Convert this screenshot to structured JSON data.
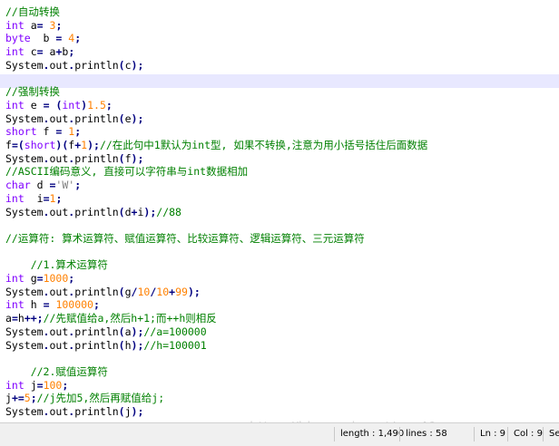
{
  "editor": {
    "lines": [
      [
        [
          "cmt",
          "//自动转换"
        ]
      ],
      [
        [
          "kw",
          "int"
        ],
        [
          "plain",
          " a"
        ],
        [
          "op",
          "="
        ],
        [
          "plain",
          " "
        ],
        [
          "num",
          "3"
        ],
        [
          "op",
          ";"
        ]
      ],
      [
        [
          "kw",
          "byte"
        ],
        [
          "plain",
          "  b "
        ],
        [
          "op",
          "="
        ],
        [
          "plain",
          " "
        ],
        [
          "num",
          "4"
        ],
        [
          "op",
          ";"
        ]
      ],
      [
        [
          "kw",
          "int"
        ],
        [
          "plain",
          " c"
        ],
        [
          "op",
          "="
        ],
        [
          "plain",
          " a"
        ],
        [
          "op",
          "+"
        ],
        [
          "plain",
          "b"
        ],
        [
          "op",
          ";"
        ]
      ],
      [
        [
          "plain",
          "System"
        ],
        [
          "op",
          "."
        ],
        [
          "plain",
          "out"
        ],
        [
          "op",
          "."
        ],
        [
          "plain",
          "println"
        ],
        [
          "op",
          "("
        ],
        [
          "plain",
          "c"
        ],
        [
          "op",
          ");"
        ]
      ],
      [],
      [
        [
          "cmt",
          "//强制转换"
        ]
      ],
      [
        [
          "kw",
          "int"
        ],
        [
          "plain",
          " e "
        ],
        [
          "op",
          "="
        ],
        [
          "plain",
          " "
        ],
        [
          "op",
          "("
        ],
        [
          "kw",
          "int"
        ],
        [
          "op",
          ")"
        ],
        [
          "num",
          "1.5"
        ],
        [
          "op",
          ";"
        ]
      ],
      [
        [
          "plain",
          "System"
        ],
        [
          "op",
          "."
        ],
        [
          "plain",
          "out"
        ],
        [
          "op",
          "."
        ],
        [
          "plain",
          "println"
        ],
        [
          "op",
          "("
        ],
        [
          "plain",
          "e"
        ],
        [
          "op",
          ");"
        ]
      ],
      [
        [
          "kw",
          "short"
        ],
        [
          "plain",
          " f "
        ],
        [
          "op",
          "="
        ],
        [
          "plain",
          " "
        ],
        [
          "num",
          "1"
        ],
        [
          "op",
          ";"
        ]
      ],
      [
        [
          "plain",
          "f"
        ],
        [
          "op",
          "=("
        ],
        [
          "kw",
          "short"
        ],
        [
          "op",
          ")("
        ],
        [
          "plain",
          "f"
        ],
        [
          "op",
          "+"
        ],
        [
          "num",
          "1"
        ],
        [
          "op",
          ");"
        ],
        [
          "cmt",
          "//在此句中1默认为int型, 如果不转换,注意为用小括号括住后面数据"
        ]
      ],
      [
        [
          "plain",
          "System"
        ],
        [
          "op",
          "."
        ],
        [
          "plain",
          "out"
        ],
        [
          "op",
          "."
        ],
        [
          "plain",
          "println"
        ],
        [
          "op",
          "("
        ],
        [
          "plain",
          "f"
        ],
        [
          "op",
          ");"
        ]
      ],
      [
        [
          "cmt",
          "//ASCII编码意义, 直接可以字符串与int数据相加"
        ]
      ],
      [
        [
          "kw",
          "char"
        ],
        [
          "plain",
          " d "
        ],
        [
          "op",
          "="
        ],
        [
          "str",
          "'W'"
        ],
        [
          "op",
          ";"
        ]
      ],
      [
        [
          "kw",
          "int"
        ],
        [
          "plain",
          "  i"
        ],
        [
          "op",
          "="
        ],
        [
          "num",
          "1"
        ],
        [
          "op",
          ";"
        ]
      ],
      [
        [
          "plain",
          "System"
        ],
        [
          "op",
          "."
        ],
        [
          "plain",
          "out"
        ],
        [
          "op",
          "."
        ],
        [
          "plain",
          "println"
        ],
        [
          "op",
          "("
        ],
        [
          "plain",
          "d"
        ],
        [
          "op",
          "+"
        ],
        [
          "plain",
          "i"
        ],
        [
          "op",
          ");"
        ],
        [
          "cmt",
          "//88"
        ]
      ],
      [],
      [
        [
          "cmt",
          "//运算符: 算术运算符、赋值运算符、比较运算符、逻辑运算符、三元运算符"
        ]
      ],
      [],
      [
        [
          "plain",
          "    "
        ],
        [
          "cmt",
          "//1.算术运算符"
        ]
      ],
      [
        [
          "kw",
          "int"
        ],
        [
          "plain",
          " g"
        ],
        [
          "op",
          "="
        ],
        [
          "num",
          "1000"
        ],
        [
          "op",
          ";"
        ]
      ],
      [
        [
          "plain",
          "System"
        ],
        [
          "op",
          "."
        ],
        [
          "plain",
          "out"
        ],
        [
          "op",
          "."
        ],
        [
          "plain",
          "println"
        ],
        [
          "op",
          "("
        ],
        [
          "plain",
          "g"
        ],
        [
          "op",
          "/"
        ],
        [
          "num",
          "10"
        ],
        [
          "op",
          "/"
        ],
        [
          "num",
          "10"
        ],
        [
          "op",
          "+"
        ],
        [
          "num",
          "99"
        ],
        [
          "op",
          ");"
        ]
      ],
      [
        [
          "kw",
          "int"
        ],
        [
          "plain",
          " h "
        ],
        [
          "op",
          "="
        ],
        [
          "plain",
          " "
        ],
        [
          "num",
          "100000"
        ],
        [
          "op",
          ";"
        ]
      ],
      [
        [
          "plain",
          "a"
        ],
        [
          "op",
          "="
        ],
        [
          "plain",
          "h"
        ],
        [
          "op",
          "++;"
        ],
        [
          "cmt",
          "//先赋值给a,然后h+1;而++h则相反"
        ]
      ],
      [
        [
          "plain",
          "System"
        ],
        [
          "op",
          "."
        ],
        [
          "plain",
          "out"
        ],
        [
          "op",
          "."
        ],
        [
          "plain",
          "println"
        ],
        [
          "op",
          "("
        ],
        [
          "plain",
          "a"
        ],
        [
          "op",
          ");"
        ],
        [
          "cmt",
          "//a=100000"
        ]
      ],
      [
        [
          "plain",
          "System"
        ],
        [
          "op",
          "."
        ],
        [
          "plain",
          "out"
        ],
        [
          "op",
          "."
        ],
        [
          "plain",
          "println"
        ],
        [
          "op",
          "("
        ],
        [
          "plain",
          "h"
        ],
        [
          "op",
          ");"
        ],
        [
          "cmt",
          "//h=100001"
        ]
      ],
      [],
      [
        [
          "plain",
          "    "
        ],
        [
          "cmt",
          "//2.赋值运算符"
        ]
      ],
      [
        [
          "kw",
          "int"
        ],
        [
          "plain",
          " j"
        ],
        [
          "op",
          "="
        ],
        [
          "num",
          "100"
        ],
        [
          "op",
          ";"
        ]
      ],
      [
        [
          "plain",
          "j"
        ],
        [
          "op",
          "+="
        ],
        [
          "num",
          "5"
        ],
        [
          "op",
          ";"
        ],
        [
          "cmt",
          "//j先加5,然后再赋值给j;"
        ]
      ],
      [
        [
          "plain",
          "System"
        ],
        [
          "op",
          "."
        ],
        [
          "plain",
          "out"
        ],
        [
          "op",
          "."
        ],
        [
          "plain",
          "println"
        ],
        [
          "op",
          "("
        ],
        [
          "plain",
          "j"
        ],
        [
          "op",
          ");"
        ]
      ]
    ],
    "current_line_index": 5
  },
  "statusbar": {
    "length": "length : 1,490",
    "lines": "lines : 58",
    "ln": "Ln : 9",
    "col": "Col : 9",
    "sel": "Se"
  },
  "watermark": "https://blog.csdn.net/qq_40"
}
